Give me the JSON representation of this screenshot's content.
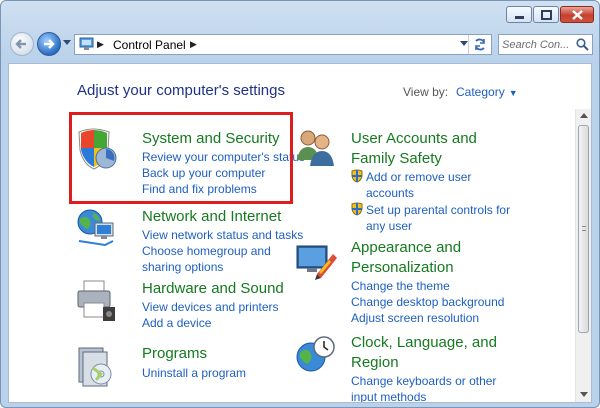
{
  "window": {
    "controls": [
      "minimize",
      "maximize",
      "close"
    ]
  },
  "address_bar": {
    "breadcrumb": "Control Panel"
  },
  "search": {
    "placeholder": "Search Con..."
  },
  "content": {
    "heading": "Adjust your computer's settings",
    "view_by_label": "View by:",
    "view_by_value": "Category"
  },
  "categories": {
    "system_security": {
      "title": "System and Security",
      "links": [
        "Review your computer's status",
        "Back up your computer",
        "Find and fix problems"
      ],
      "icon": "shield-icon"
    },
    "network": {
      "title": "Network and Internet",
      "links": [
        "View network status and tasks",
        "Choose homegroup and",
        "sharing options"
      ],
      "icon": "globe-network-icon"
    },
    "hardware": {
      "title": "Hardware and Sound",
      "links": [
        "View devices and printers",
        "Add a device"
      ],
      "icon": "printer-icon"
    },
    "programs": {
      "title": "Programs",
      "links": [
        "Uninstall a program"
      ],
      "icon": "programs-icon"
    },
    "user_accounts": {
      "title_line1": "User Accounts and",
      "title_line2": "Family Safety",
      "links": [
        "Add or remove user",
        "accounts",
        "Set up parental controls for",
        "any user"
      ],
      "icon": "users-icon"
    },
    "appearance": {
      "title_line1": "Appearance and",
      "title_line2": "Personalization",
      "links": [
        "Change the theme",
        "Change desktop background",
        "Adjust screen resolution"
      ],
      "icon": "monitor-icon"
    },
    "clock": {
      "title_line1": "Clock, Language, and",
      "title_line2": "Region",
      "links": [
        "Change keyboards or other",
        "input methods"
      ],
      "icon": "clock-globe-icon"
    }
  },
  "colors": {
    "category_title": "#157a1f",
    "link": "#1e5fc1",
    "heading": "#1e3287",
    "highlight": "#e01d1d"
  }
}
